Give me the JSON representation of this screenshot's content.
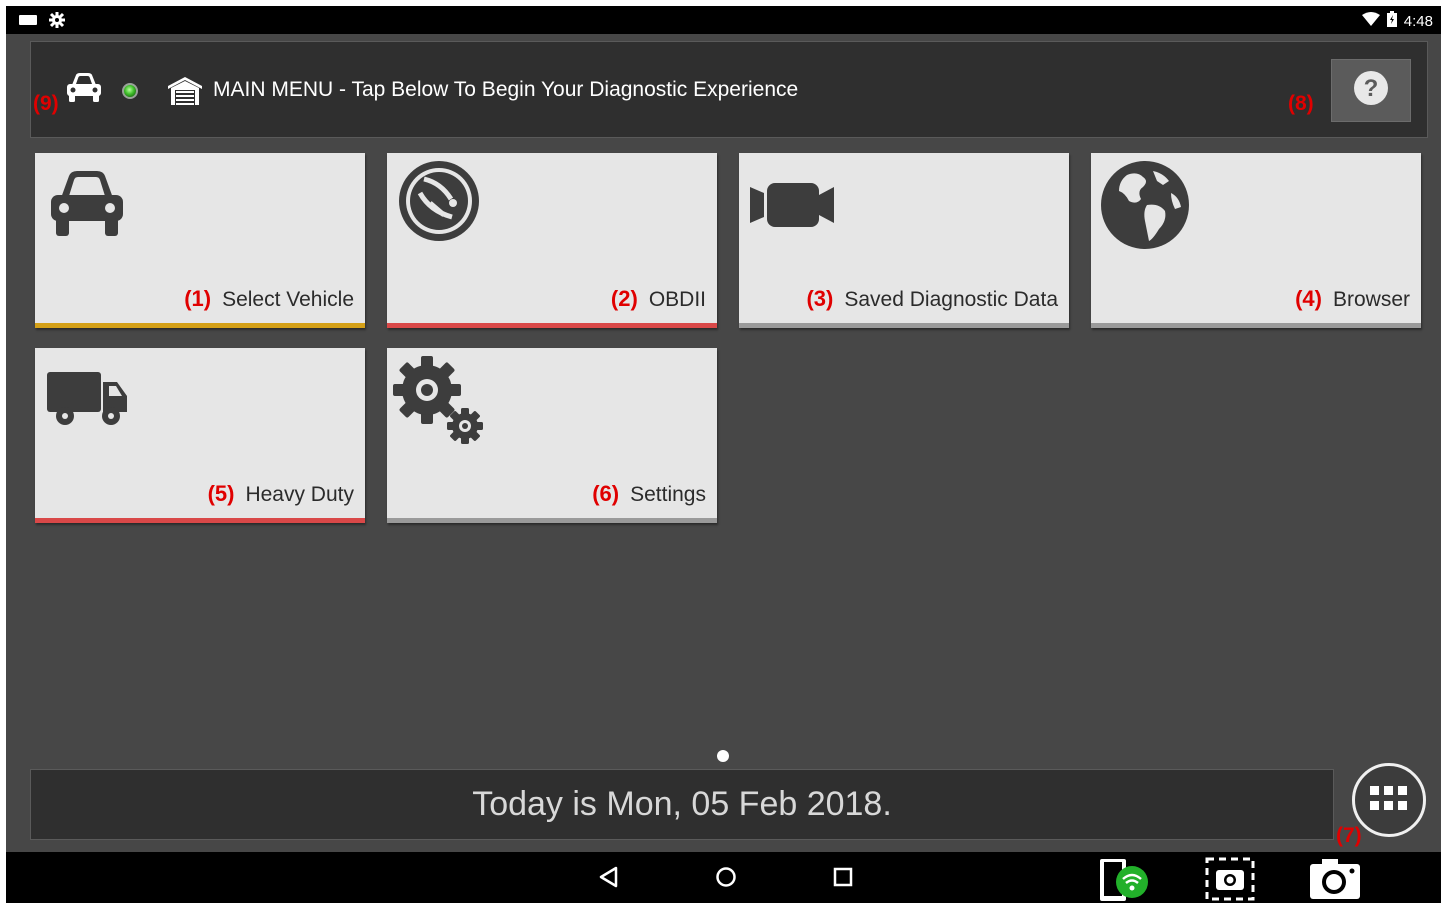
{
  "status_bar": {
    "left_icons": [
      "notification-icon",
      "settings-notification-icon"
    ],
    "right_icons": [
      "wifi-icon",
      "battery-icon"
    ],
    "clock": "4:48"
  },
  "header": {
    "marker_left": "(9)",
    "title": "MAIN MENU - Tap Below To Begin Your Diagnostic Experience",
    "marker_right": "(8)",
    "help_icon": "?",
    "connection_led_color": "#3fbf2a"
  },
  "tiles": [
    {
      "num": "(1)",
      "label": "Select Vehicle",
      "icon": "car-icon",
      "bar_color": "#d4a017"
    },
    {
      "num": "(2)",
      "label": "OBDII",
      "icon": "obd-scan-icon",
      "bar_color": "#d94848"
    },
    {
      "num": "(3)",
      "label": "Saved Diagnostic Data",
      "icon": "video-camera-icon",
      "bar_color": "#9a9a9a"
    },
    {
      "num": "(4)",
      "label": "Browser",
      "icon": "globe-icon",
      "bar_color": "#9a9a9a"
    },
    {
      "num": "(5)",
      "label": "Heavy Duty",
      "icon": "truck-icon",
      "bar_color": "#d94848"
    },
    {
      "num": "(6)",
      "label": "Settings",
      "icon": "gears-icon",
      "bar_color": "#9a9a9a"
    }
  ],
  "date_bar": {
    "text": "Today is Mon, 05 Feb 2018."
  },
  "apps_button": {
    "marker": "(7)",
    "icon": "apps-grid-icon"
  },
  "nav_bar": {
    "buttons": [
      "back-icon",
      "home-icon",
      "recents-icon"
    ],
    "tools": [
      "device-wifi-icon",
      "screen-capture-icon",
      "camera-icon"
    ]
  }
}
